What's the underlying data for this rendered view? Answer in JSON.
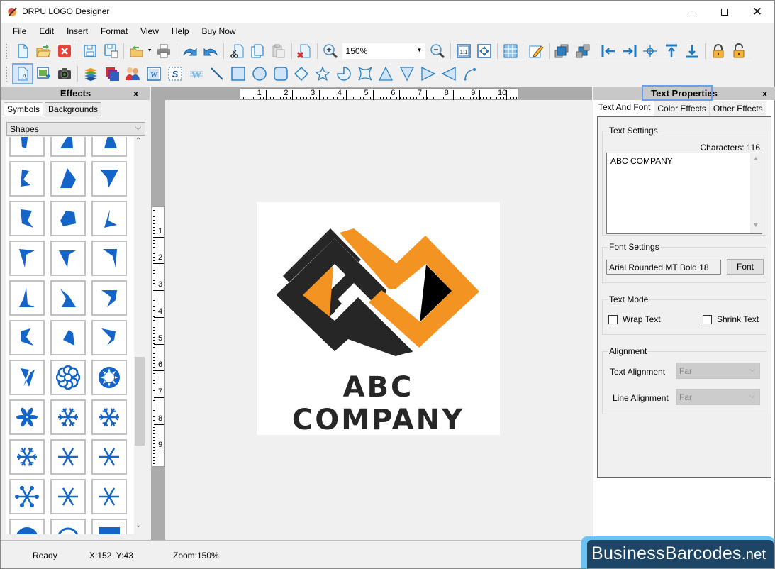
{
  "window": {
    "title": "DRPU LOGO Designer",
    "controls": [
      "minimize",
      "maximize",
      "close"
    ]
  },
  "menu": [
    "File",
    "Edit",
    "Insert",
    "Format",
    "View",
    "Help",
    "Buy Now"
  ],
  "toolbar1": {
    "buttons": [
      "new-document",
      "open-folder",
      "close-document",
      "save",
      "save-as",
      "export",
      "print",
      "undo",
      "redo",
      "cut",
      "copy",
      "paste",
      "delete",
      "zoom-in",
      "zoom-out",
      "actual-size",
      "fit-to-window",
      "grid",
      "edit-properties",
      "bring-to-front",
      "send-to-back",
      "align-left",
      "align-right",
      "align-center",
      "align-top",
      "align-bottom",
      "lock",
      "unlock"
    ],
    "zoom_value": "150%"
  },
  "toolbar2": {
    "buttons": [
      "text-tool",
      "insert-image",
      "camera",
      "layers",
      "background",
      "users-clipart",
      "word-art",
      "signature",
      "watermark",
      "line",
      "rectangle",
      "ellipse",
      "rounded-rectangle",
      "diamond",
      "star",
      "pie",
      "concave-star",
      "triangle-up",
      "triangle-down",
      "triangle-right",
      "triangle-left",
      "arc"
    ]
  },
  "effects_panel": {
    "title": "Effects",
    "close": "x",
    "tabs": [
      "Symbols",
      "Backgrounds"
    ],
    "selected_tab": "Symbols",
    "category": "Shapes",
    "symbols": [
      "shape-1",
      "shape-2",
      "shape-3",
      "shape-4",
      "shape-5",
      "shape-6",
      "shape-7",
      "shape-8",
      "shape-9",
      "shape-10",
      "shape-11",
      "shape-12",
      "shape-13",
      "shape-14",
      "shape-15",
      "shape-16",
      "shape-17",
      "shape-18",
      "shape-19",
      "flower",
      "sun-ring",
      "snowflake-1",
      "snowflake-2",
      "snowflake-3",
      "snowflake-4",
      "snowflake-5",
      "snowflake-6",
      "snowflake-7",
      "snowflake-8",
      "asterisk",
      "circle",
      "ring",
      "square"
    ]
  },
  "rulers": {
    "horizontal": [
      "1",
      "2",
      "3",
      "4",
      "5",
      "6",
      "7",
      "8",
      "9",
      "10"
    ],
    "vertical": [
      "1",
      "2",
      "3",
      "4",
      "5",
      "6",
      "7",
      "8",
      "9"
    ]
  },
  "canvas": {
    "company_name": "ABC COMPANY",
    "colors": {
      "dark": "#262626",
      "orange": "#f39322",
      "black": "#000000"
    }
  },
  "text_properties": {
    "title": "Text Properties",
    "close": "x",
    "tabs": [
      "Text And Font",
      "Color Effects",
      "Other Effects"
    ],
    "selected_tab": "Text And Font",
    "text_settings": {
      "legend": "Text Settings",
      "characters_label": "Characters: 116",
      "text": "ABC COMPANY"
    },
    "font_settings": {
      "legend": "Font Settings",
      "font_value": "Arial Rounded MT Bold,18",
      "font_button": "Font"
    },
    "text_mode": {
      "legend": "Text Mode",
      "wrap_text": {
        "label": "Wrap Text",
        "checked": false
      },
      "shrink_text": {
        "label": "Shrink Text",
        "checked": false
      }
    },
    "alignment": {
      "legend": "Alignment",
      "text_alignment_label": "Text Alignment",
      "text_alignment_value": "Far",
      "line_alignment_label": "Line Alignment",
      "line_alignment_value": "Far"
    }
  },
  "status": {
    "state": "Ready",
    "coords": "X:152  Y:43",
    "zoom": "Zoom:150%"
  },
  "brand": {
    "main": "BusinessBarcodes",
    "suffix": ".net"
  }
}
